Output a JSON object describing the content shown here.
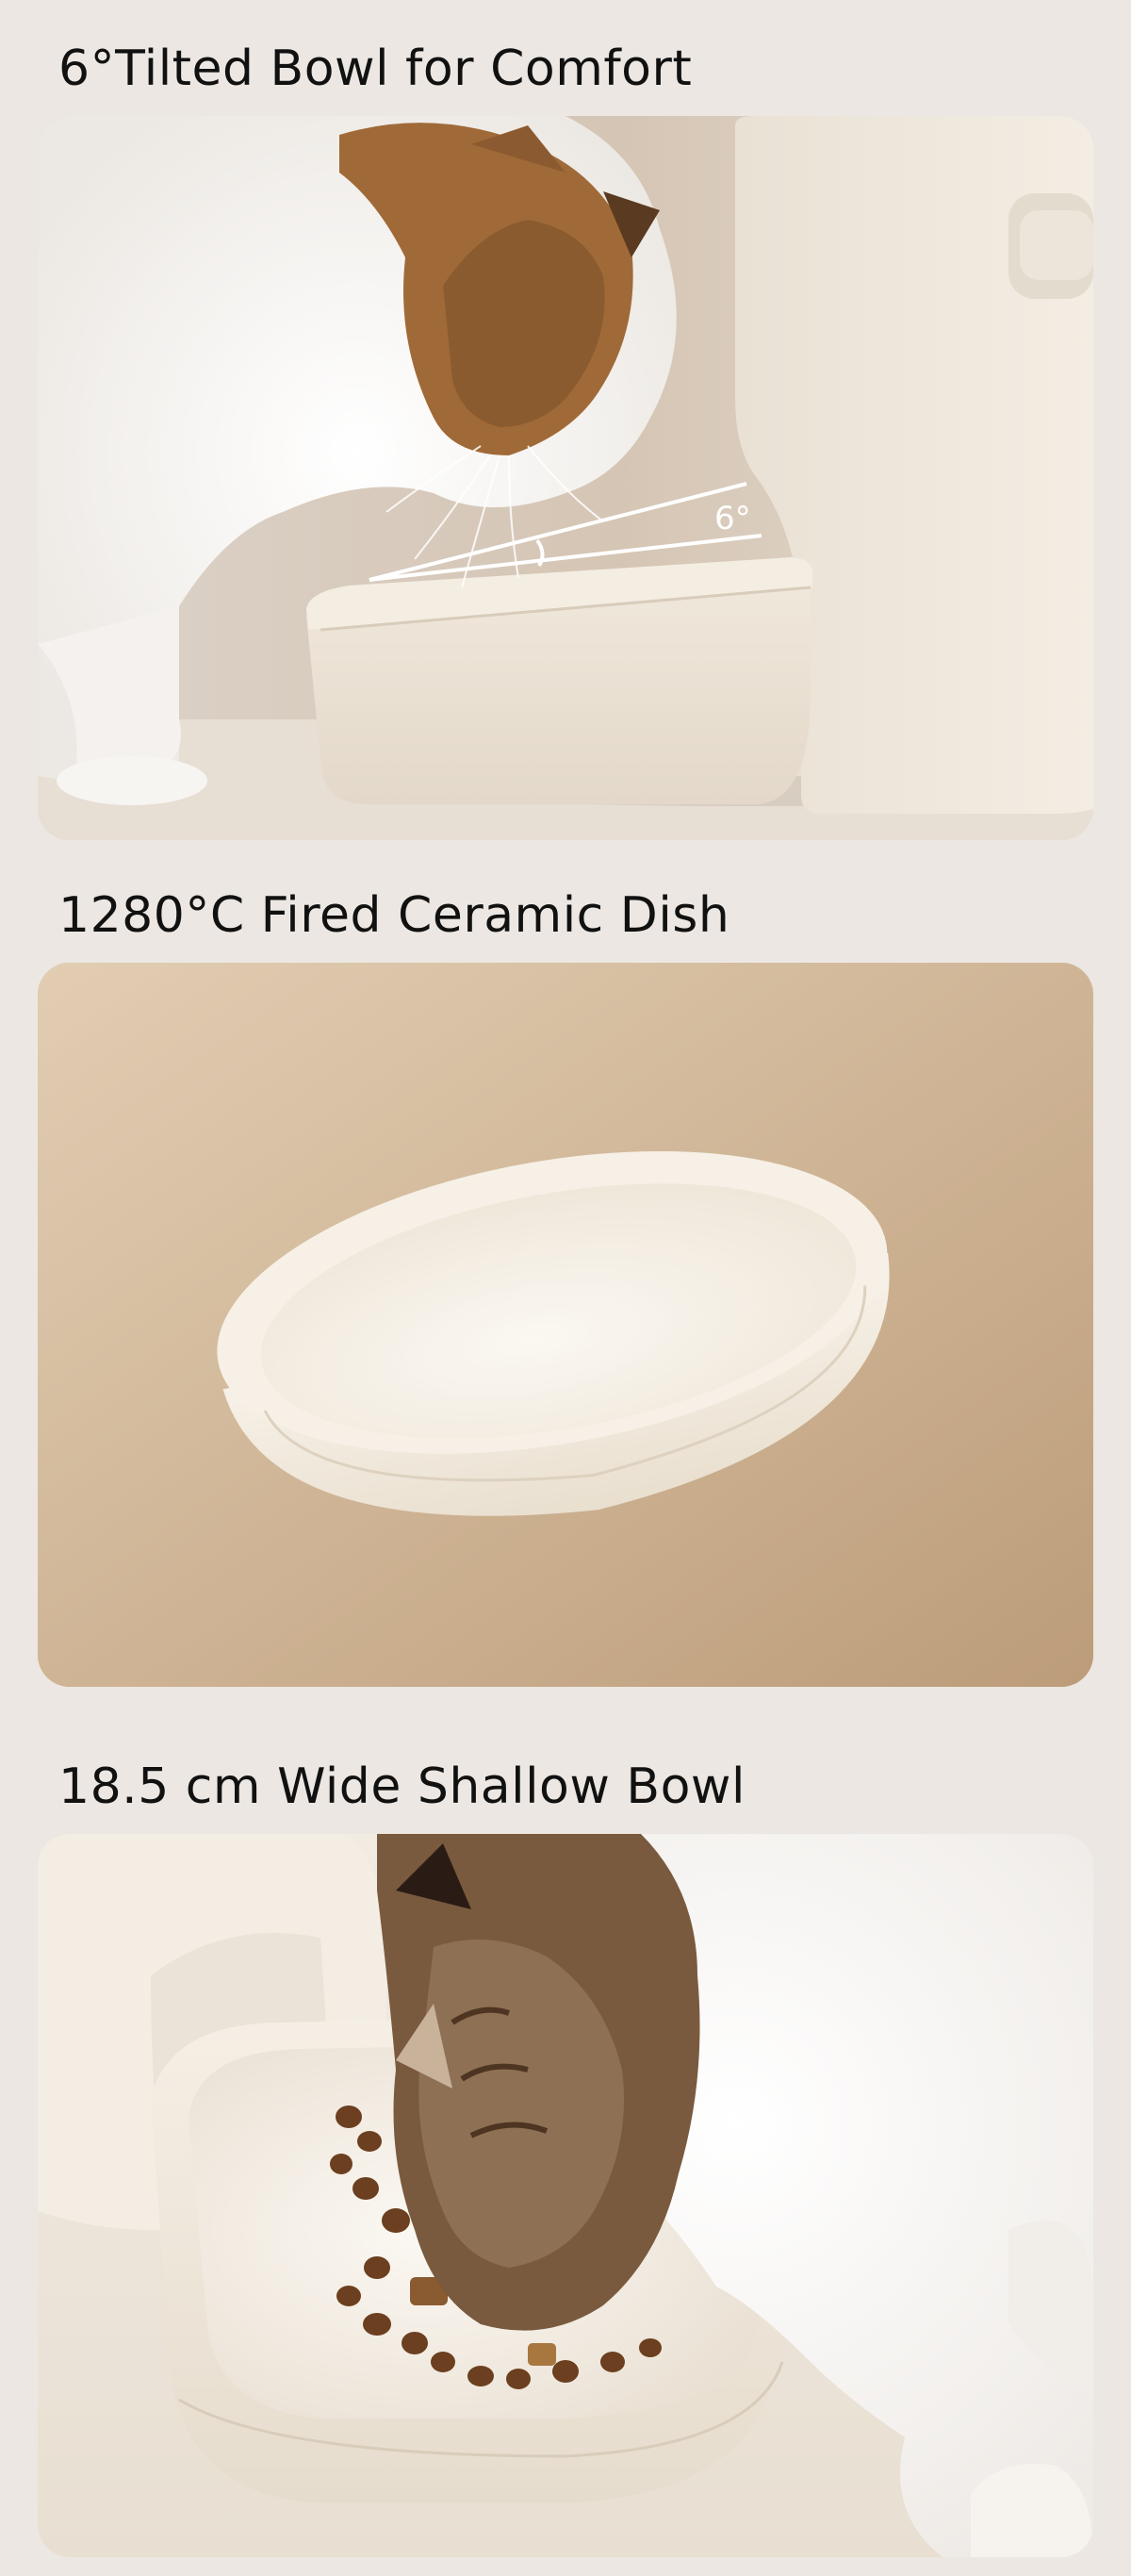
{
  "sections": [
    {
      "title": "6°Tilted Bowl for Comfort",
      "angle_label": "6°"
    },
    {
      "title": "1280°C Fired Ceramic Dish"
    },
    {
      "title": "18.5 cm Wide Shallow Bowl"
    }
  ],
  "colors": {
    "background": "#ece7e2",
    "text": "#111111",
    "panel_cream": "#efe7dc",
    "panel_tan": "#c8ae90",
    "ceramic_white": "#f7f1e6"
  }
}
